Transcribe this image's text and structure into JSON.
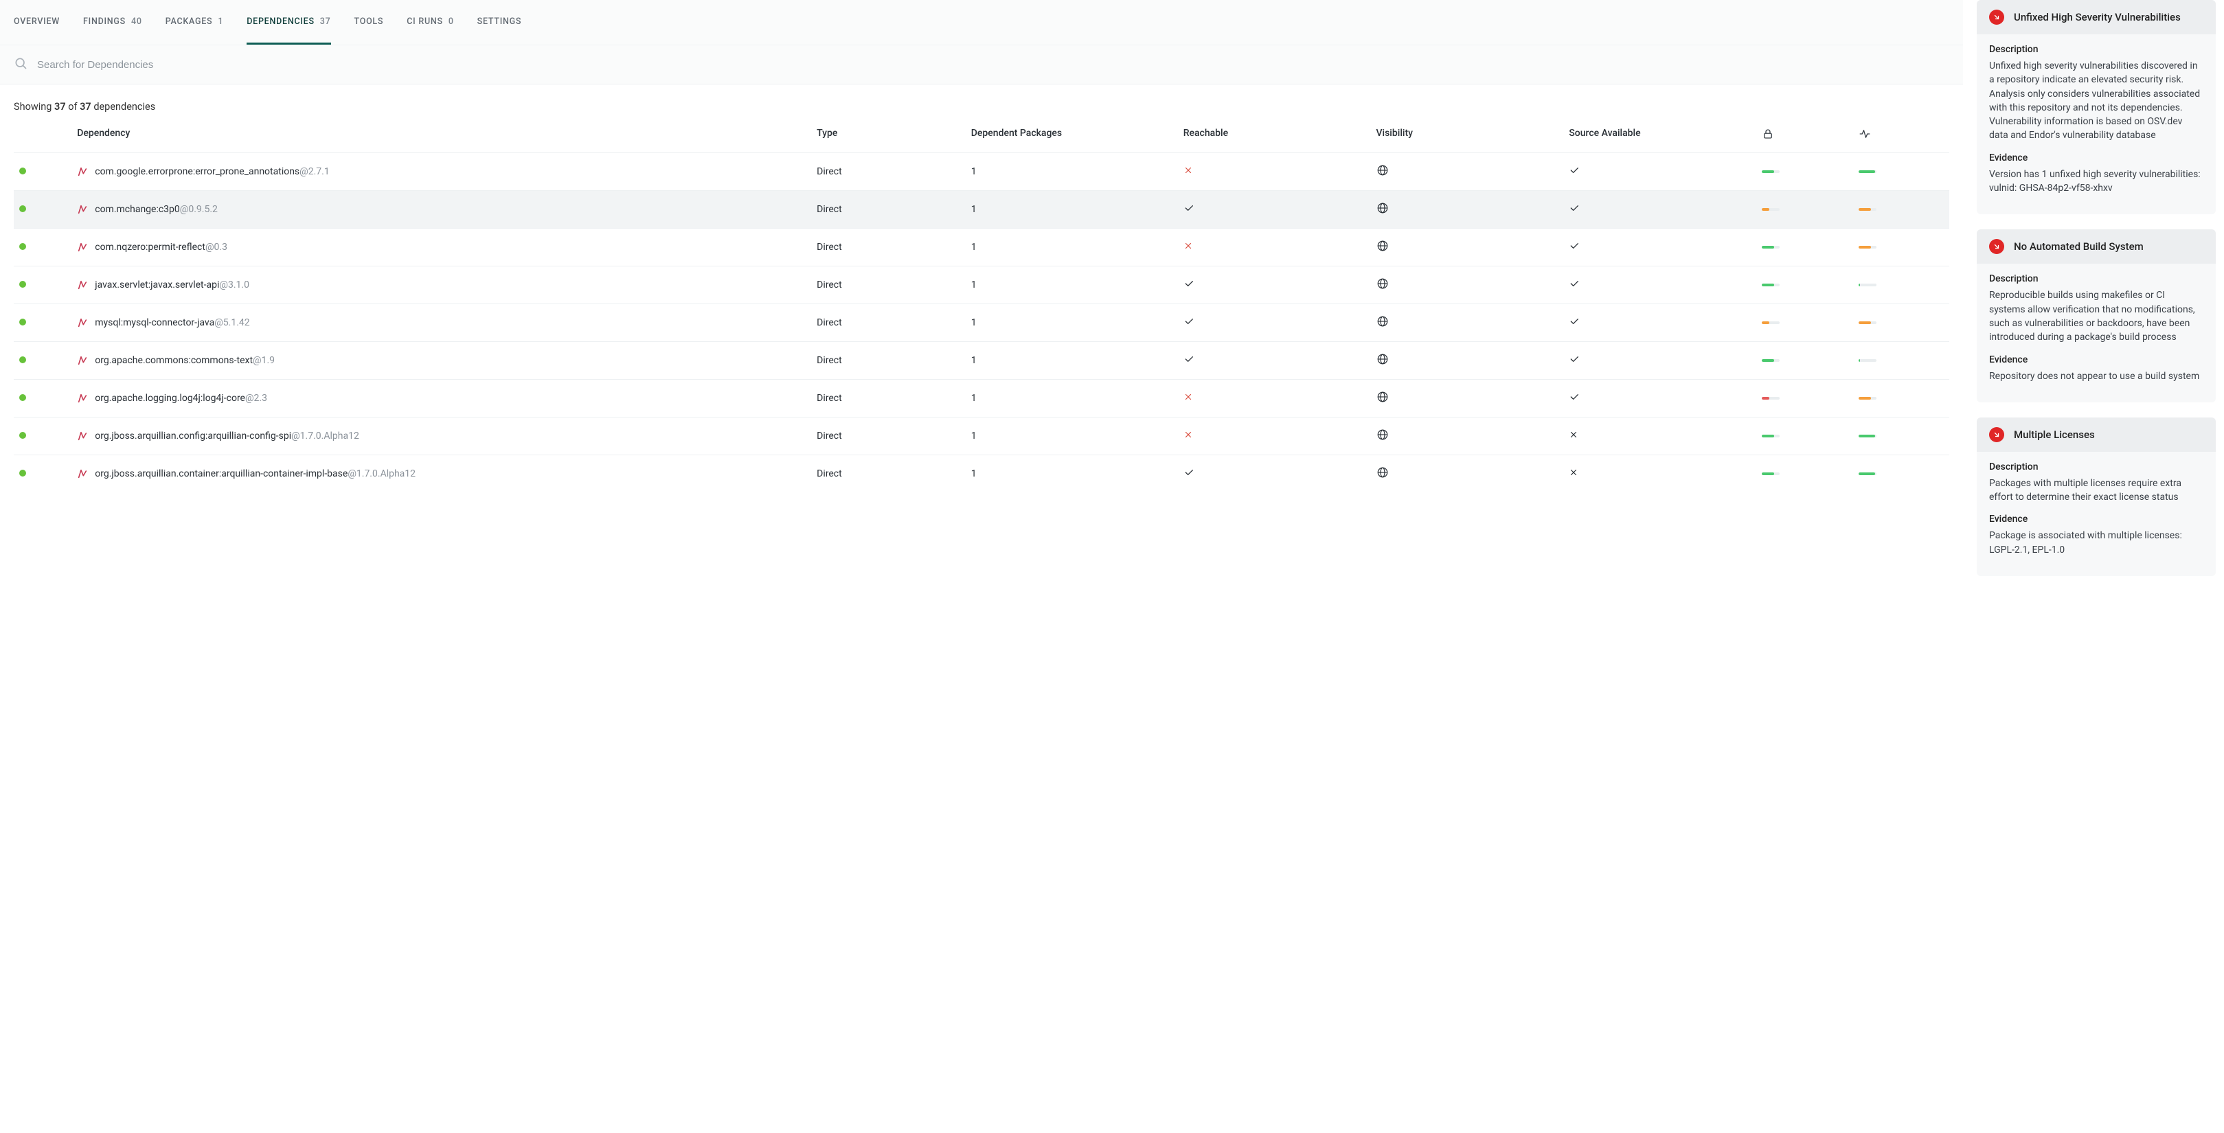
{
  "tabs": [
    {
      "label": "OVERVIEW",
      "count": ""
    },
    {
      "label": "FINDINGS",
      "count": "40"
    },
    {
      "label": "PACKAGES",
      "count": "1"
    },
    {
      "label": "DEPENDENCIES",
      "count": "37"
    },
    {
      "label": "TOOLS",
      "count": ""
    },
    {
      "label": "CI RUNS",
      "count": "0"
    },
    {
      "label": "SETTINGS",
      "count": ""
    }
  ],
  "active_tab": 3,
  "search": {
    "placeholder": "Search for Dependencies"
  },
  "showing": {
    "prefix": "Showing ",
    "shown": "37",
    "of_text": " of ",
    "total": "37",
    "suffix": " dependencies"
  },
  "columns": {
    "dependency": "Dependency",
    "type": "Type",
    "dependent_packages": "Dependent Packages",
    "reachable": "Reachable",
    "visibility": "Visibility",
    "source_available": "Source Available"
  },
  "rows": [
    {
      "name": "com.google.errorprone:error_prone_annotations",
      "version": "@2.7.1",
      "type": "Direct",
      "dep_pkgs": "1",
      "reachable": false,
      "vis": "public",
      "src": true,
      "bar1": {
        "color": "green",
        "pct": 70
      },
      "bar2": {
        "color": "green",
        "pct": 95
      },
      "selected": false
    },
    {
      "name": "com.mchange:c3p0",
      "version": "@0.9.5.2",
      "type": "Direct",
      "dep_pkgs": "1",
      "reachable": true,
      "vis": "public",
      "src": true,
      "bar1": {
        "color": "orange",
        "pct": 40
      },
      "bar2": {
        "color": "orange",
        "pct": 70
      },
      "selected": true
    },
    {
      "name": "com.nqzero:permit-reflect",
      "version": "@0.3",
      "type": "Direct",
      "dep_pkgs": "1",
      "reachable": false,
      "vis": "public",
      "src": true,
      "bar1": {
        "color": "green",
        "pct": 70
      },
      "bar2": {
        "color": "orange",
        "pct": 70
      },
      "selected": false
    },
    {
      "name": "javax.servlet:javax.servlet-api",
      "version": "@3.1.0",
      "type": "Direct",
      "dep_pkgs": "1",
      "reachable": true,
      "vis": "public",
      "src": true,
      "bar1": {
        "color": "green",
        "pct": 70
      },
      "bar2": {
        "color": "green",
        "pct": 10
      },
      "selected": false
    },
    {
      "name": "mysql:mysql-connector-java",
      "version": "@5.1.42",
      "type": "Direct",
      "dep_pkgs": "1",
      "reachable": true,
      "vis": "public",
      "src": true,
      "bar1": {
        "color": "orange",
        "pct": 40
      },
      "bar2": {
        "color": "orange",
        "pct": 70
      },
      "selected": false
    },
    {
      "name": "org.apache.commons:commons-text",
      "version": "@1.9",
      "type": "Direct",
      "dep_pkgs": "1",
      "reachable": true,
      "vis": "public",
      "src": true,
      "bar1": {
        "color": "green",
        "pct": 70
      },
      "bar2": {
        "color": "green",
        "pct": 10
      },
      "selected": false
    },
    {
      "name": "org.apache.logging.log4j:log4j-core",
      "version": "@2.3",
      "type": "Direct",
      "dep_pkgs": "1",
      "reachable": false,
      "vis": "public",
      "src": true,
      "bar1": {
        "color": "red",
        "pct": 40
      },
      "bar2": {
        "color": "orange",
        "pct": 70
      },
      "selected": false
    },
    {
      "name": "org.jboss.arquillian.config:arquillian-config-spi",
      "version": "@1.7.0.Alpha12",
      "type": "Direct",
      "dep_pkgs": "1",
      "reachable": false,
      "vis": "public",
      "src": false,
      "bar1": {
        "color": "green",
        "pct": 70
      },
      "bar2": {
        "color": "green",
        "pct": 95
      },
      "selected": false
    },
    {
      "name": "org.jboss.arquillian.container:arquillian-container-impl-base",
      "version": "@1.7.0.Alpha12",
      "type": "Direct",
      "dep_pkgs": "1",
      "reachable": true,
      "vis": "public",
      "src": false,
      "bar1": {
        "color": "green",
        "pct": 70
      },
      "bar2": {
        "color": "green",
        "pct": 95
      },
      "selected": false
    }
  ],
  "panels": [
    {
      "title": "Unfixed High Severity Vulnerabilities",
      "desc_label": "Description",
      "desc": "Unfixed high severity vulnerabilities discovered in a repository indicate an elevated security risk. Analysis only considers vulnerabilities associated with this repository and not its dependencies. Vulnerability information is based on OSV.dev data and Endor's vulnerability database",
      "ev_label": "Evidence",
      "ev": "Version has 1 unfixed high severity vulnerabilities: vulnid: GHSA-84p2-vf58-xhxv"
    },
    {
      "title": "No Automated Build System",
      "desc_label": "Description",
      "desc": "Reproducible builds using makefiles or CI systems allow verification that no modifications, such as vulnerabilities or backdoors, have been introduced during a package's build process",
      "ev_label": "Evidence",
      "ev": "Repository does not appear to use a build system"
    },
    {
      "title": "Multiple Licenses",
      "desc_label": "Description",
      "desc": "Packages with multiple licenses require extra effort to determine their exact license status",
      "ev_label": "Evidence",
      "ev": "Package is associated with multiple licenses: LGPL-2.1, EPL-1.0"
    }
  ]
}
